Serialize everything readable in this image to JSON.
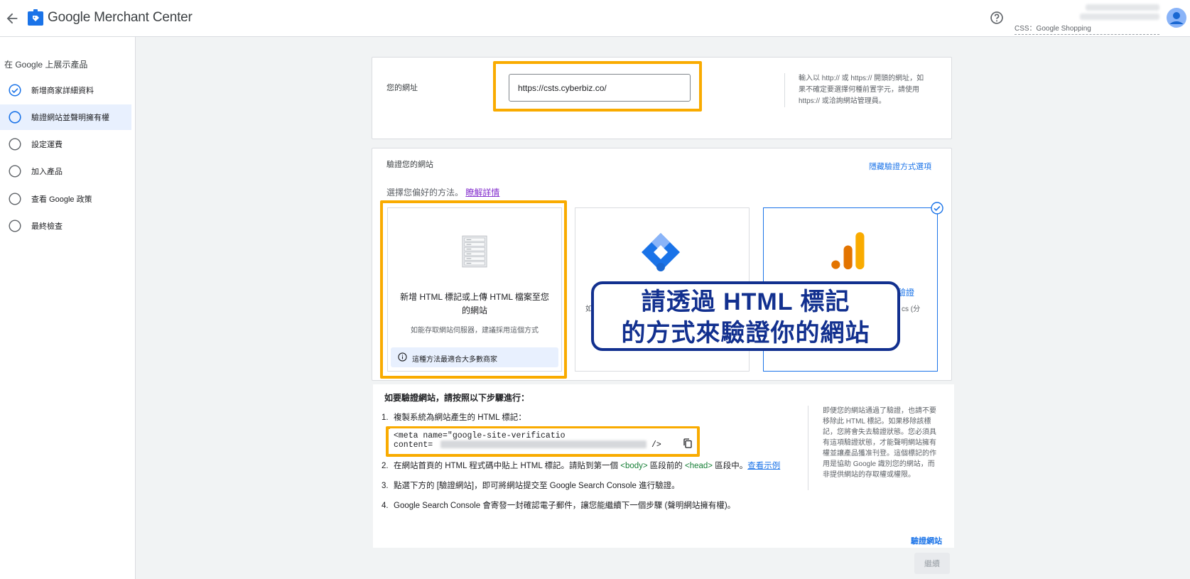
{
  "header": {
    "title": "Google Merchant Center",
    "account_name": "CSS：Google Shopping"
  },
  "sidebar": {
    "heading": "在 Google 上展示產品",
    "items": [
      {
        "label": "新增商家詳細資料",
        "state": "done"
      },
      {
        "label": "驗證網站並聲明擁有權",
        "state": "active"
      },
      {
        "label": "設定運費",
        "state": "todo"
      },
      {
        "label": "加入產品",
        "state": "todo"
      },
      {
        "label": "查看 Google 政策",
        "state": "todo"
      },
      {
        "label": "最終檢查",
        "state": "todo"
      }
    ]
  },
  "url_section": {
    "label": "您的網址",
    "value": "https://csts.cyberbiz.co/",
    "help": "輸入以 http:// 或 https:// 開頭的網址，如果不確定要選擇何種前置字元，請使用 https:// 或洽詢網站管理員。"
  },
  "verify_section": {
    "title": "驗證您的網站",
    "hide_options": "隱藏驗證方式選項",
    "choose": "選擇您偏好的方法。",
    "learn_more": "瞭解詳情",
    "options": [
      {
        "title": "新增 HTML 標記或上傳 HTML 檔案至您的網站",
        "subtitle": "如能存取網站伺服器，建議採用這個方式",
        "banner": "這種方法最適合大多數商家",
        "icon": "server-icon"
      },
      {
        "title": "",
        "subtitle": "如",
        "icon": "google-tag-manager-icon"
      },
      {
        "title": "行驗證",
        "subtitle": "cs (分",
        "icon": "google-analytics-icon"
      }
    ]
  },
  "callout": {
    "line1": "請透過 HTML 標記",
    "line2": "的方式來驗證你的網站"
  },
  "steps": {
    "title": "如要驗證網站，請按照以下步驟進行：",
    "step1": {
      "num": "1.",
      "text": "複製系統為網站產生的 HTML 標記："
    },
    "code_line1": "<meta name=\"google-site-verificatio",
    "code_content": "content=",
    "code_end": "/>",
    "step2": {
      "num": "2.",
      "text_a": "在網站首頁的 HTML 程式碼中貼上 HTML 標記。請貼到第一個 ",
      "body_tag": "<body>",
      "text_b": " 區段前的 ",
      "head_tag": "<head>",
      "text_c": " 區段中。",
      "link": "查看示例"
    },
    "step3": {
      "num": "3.",
      "text": "點選下方的 [驗證網站]，即可將網站提交至 Google Search Console 進行驗證。"
    },
    "step4": {
      "num": "4.",
      "text": "Google Search Console 會寄發一封確認電子郵件，讓您能繼續下一個步驟 (聲明網站擁有權)。"
    },
    "help": "即便您的網站通過了驗證，也請不要移除此 HTML 標記。如果移除該標記，您將會失去驗證狀態。您必須具有這項驗證狀態，才能聲明網站擁有權並讓產品獲准刊登。這個標記的作用是協助 Google 識別您的網站，而非提供網站的存取權或權限。"
  },
  "actions": {
    "verify_link": "驗證網站",
    "continue": "繼續"
  },
  "colors": {
    "accent": "#1a73e8",
    "highlight": "#f9ab00",
    "callout": "#12308f"
  }
}
